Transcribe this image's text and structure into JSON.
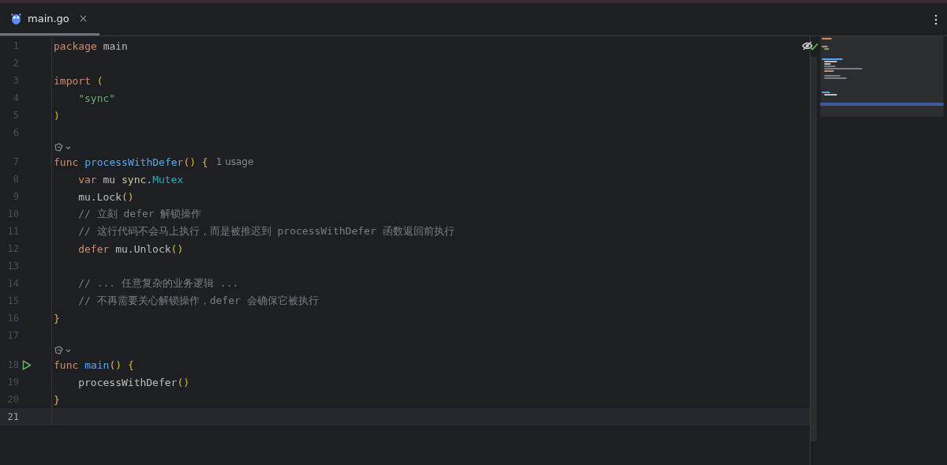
{
  "tabs": [
    {
      "label": "main.go",
      "selected": true,
      "close": "×"
    }
  ],
  "editor": {
    "lines": [
      {
        "number": "1",
        "tokens": [
          {
            "kind": "keyword",
            "text": "package "
          },
          {
            "kind": "plain",
            "text": "main"
          }
        ]
      },
      {
        "number": "2"
      },
      {
        "number": "3",
        "tokens": [
          {
            "kind": "keyword",
            "text": "import "
          },
          {
            "kind": "bracket",
            "text": "("
          }
        ]
      },
      {
        "number": "4",
        "indented": true,
        "tokens": [
          {
            "kind": "string",
            "text": "\"sync\""
          }
        ]
      },
      {
        "number": "5",
        "tokens": [
          {
            "kind": "bracket",
            "text": ")"
          }
        ]
      },
      {
        "number": "6"
      },
      {
        "number": "7",
        "code_vision": true,
        "hint": "1 usage",
        "tokens": [
          {
            "kind": "keyword",
            "text": "func "
          },
          {
            "kind": "decl",
            "text": "processWithDefer"
          },
          {
            "kind": "bracket",
            "text": "() {"
          }
        ]
      },
      {
        "number": "8",
        "indented": true,
        "tokens": [
          {
            "kind": "keyword",
            "text": "var "
          },
          {
            "kind": "plain",
            "text": "mu "
          },
          {
            "kind": "package",
            "text": "sync"
          },
          {
            "kind": "plain",
            "text": "."
          },
          {
            "kind": "type",
            "text": "Mutex"
          }
        ]
      },
      {
        "number": "9",
        "indented": true,
        "tokens": [
          {
            "kind": "plain",
            "text": "mu.Lock"
          },
          {
            "kind": "bracket",
            "text": "()"
          }
        ]
      },
      {
        "number": "10",
        "indented": true,
        "tokens": [
          {
            "kind": "comment",
            "text": "// 立刻 defer 解锁操作"
          }
        ]
      },
      {
        "number": "11",
        "indented": true,
        "tokens": [
          {
            "kind": "comment",
            "text": "// 这行代码不会马上执行，而是被推迟到 processWithDefer 函数返回前执行"
          }
        ]
      },
      {
        "number": "12",
        "indented": true,
        "tokens": [
          {
            "kind": "keyword",
            "text": "defer "
          },
          {
            "kind": "plain",
            "text": "mu.Unlock"
          },
          {
            "kind": "bracket",
            "text": "()"
          }
        ]
      },
      {
        "number": "13"
      },
      {
        "number": "14",
        "indented": true,
        "tokens": [
          {
            "kind": "comment",
            "text": "// ... 任意复杂的业务逻辑 ..."
          }
        ]
      },
      {
        "number": "15",
        "indented": true,
        "tokens": [
          {
            "kind": "comment",
            "text": "// 不再需要关心解锁操作，defer 会确保它被执行"
          }
        ]
      },
      {
        "number": "16",
        "tokens": [
          {
            "kind": "bracket",
            "text": "}"
          }
        ]
      },
      {
        "number": "17"
      },
      {
        "number": "18",
        "code_vision": true,
        "run": true,
        "tokens": [
          {
            "kind": "keyword",
            "text": "func "
          },
          {
            "kind": "decl",
            "text": "main"
          },
          {
            "kind": "bracket",
            "text": "() {"
          }
        ]
      },
      {
        "number": "19",
        "indented": true,
        "tokens": [
          {
            "kind": "plain",
            "text": "processWithDefer"
          },
          {
            "kind": "bracket",
            "text": "()"
          }
        ]
      },
      {
        "number": "20",
        "tokens": [
          {
            "kind": "bracket",
            "text": "}"
          }
        ]
      },
      {
        "number": "21",
        "current": true
      }
    ]
  }
}
